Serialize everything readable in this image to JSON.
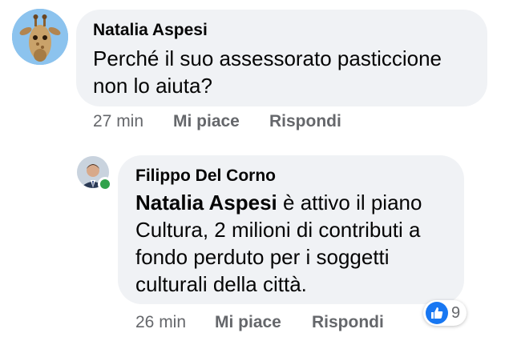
{
  "comments": [
    {
      "author": "Natalia Aspesi",
      "text_lines": [
        "Perché il suo assessorato pasticcione",
        "non lo aiuta?"
      ],
      "time": "27 min",
      "like_label": "Mi piace",
      "reply_label": "Rispondi",
      "avatar_icon": "giraffe-avatar"
    },
    {
      "author": "Filippo Del Corno",
      "mention": "Natalia Aspesi",
      "text_lines": [
        " è attivo il piano",
        "Cultura, 2 milioni di contributi a",
        "fondo perduto per i soggetti",
        "culturali della città."
      ],
      "time": "26 min",
      "like_label": "Mi piace",
      "reply_label": "Rispondi",
      "reaction_icon": "like-icon",
      "reaction_count": "9",
      "online": true
    }
  ],
  "colors": {
    "bubble": "#f0f2f5",
    "meta": "#65676b",
    "like_blue": "#1877f2",
    "online_green": "#31a24c"
  }
}
